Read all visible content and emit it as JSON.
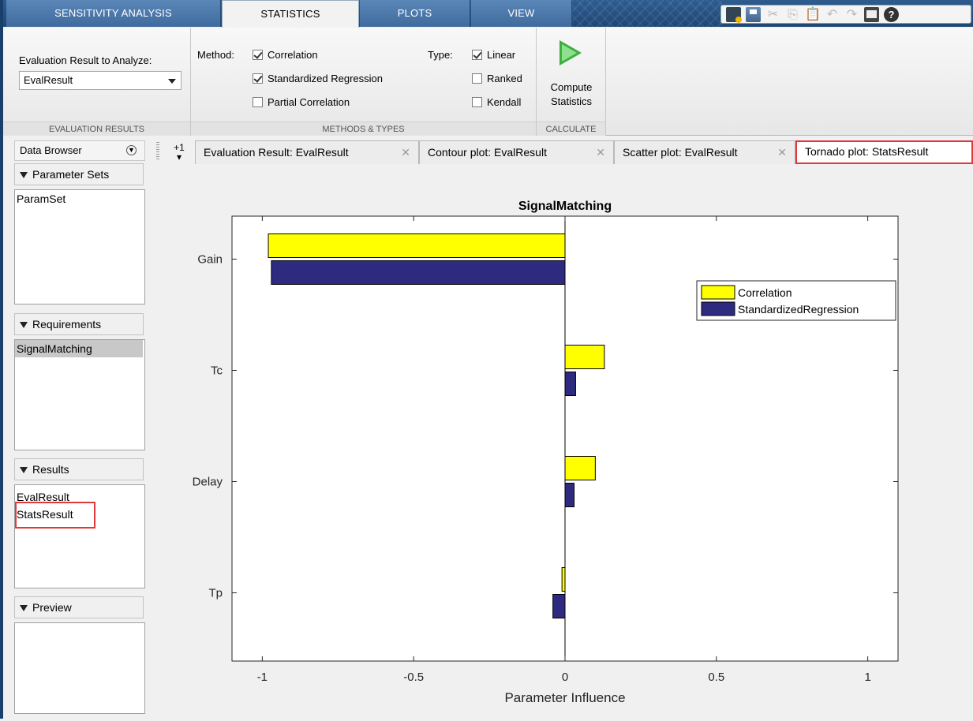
{
  "ribbon_tabs": [
    "SENSITIVITY ANALYSIS",
    "STATISTICS",
    "PLOTS",
    "VIEW"
  ],
  "ribbon": {
    "eval_label": "Evaluation Result to Analyze:",
    "eval_value": "EvalResult",
    "eval_section": "EVALUATION RESULTS",
    "method_label": "Method:",
    "methods": [
      "Correlation",
      "Standardized Regression",
      "Partial Correlation"
    ],
    "methods_checked": [
      true,
      true,
      false
    ],
    "type_label": "Type:",
    "types": [
      "Linear",
      "Ranked",
      "Kendall"
    ],
    "types_checked": [
      true,
      false,
      false
    ],
    "methods_section": "METHODS & TYPES",
    "compute_line1": "Compute",
    "compute_line2": "Statistics",
    "calc_section": "CALCULATE"
  },
  "browser": {
    "title": "Data Browser",
    "param_header": "Parameter Sets",
    "param_items": [
      "ParamSet"
    ],
    "req_header": "Requirements",
    "req_items": [
      "SignalMatching"
    ],
    "results_header": "Results",
    "results_items": [
      "EvalResult",
      "StatsResult"
    ],
    "preview_header": "Preview"
  },
  "doc_tabs": {
    "nav_label": "+1",
    "tabs": [
      "Evaluation Result:  EvalResult",
      "Contour plot:  EvalResult",
      "Scatter plot:  EvalResult",
      "Tornado plot:  StatsResult"
    ]
  },
  "chart_data": {
    "type": "bar",
    "orientation": "horizontal",
    "title": "SignalMatching",
    "xlabel": "Parameter Influence",
    "ylabel": "",
    "categories": [
      "Gain",
      "Tc",
      "Delay",
      "Tp"
    ],
    "series": [
      {
        "name": "Correlation",
        "color": "#ffff00",
        "values": [
          -0.98,
          0.13,
          0.1,
          -0.01
        ]
      },
      {
        "name": "StandardizedRegression",
        "color": "#2e2a80",
        "values": [
          -0.97,
          0.035,
          0.03,
          -0.04
        ]
      }
    ],
    "xlim": [
      -1.1,
      1.1
    ],
    "xticks": [
      -1,
      -0.5,
      0,
      0.5,
      1
    ],
    "xtick_labels": [
      "-1",
      "-0.5",
      "0",
      "0.5",
      "1"
    ],
    "legend": "top-right",
    "grid": false
  }
}
